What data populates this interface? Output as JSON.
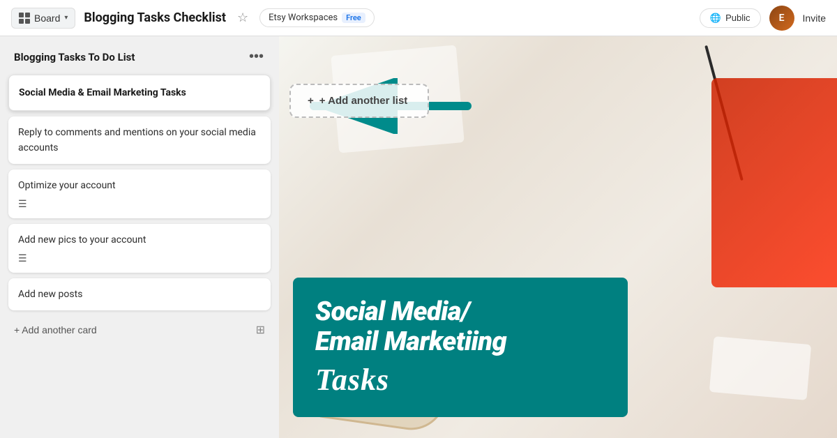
{
  "topbar": {
    "board_label": "Board",
    "page_title": "Blogging Tasks Checklist",
    "star_symbol": "☆",
    "workspace_label": "Etsy Workspaces",
    "free_badge": "Free",
    "public_label": "Public",
    "invite_label": "Invite",
    "avatar_initials": "E"
  },
  "list": {
    "title": "Blogging Tasks To Do List",
    "menu_symbol": "•••",
    "add_another_list": "+ Add another list",
    "cards": [
      {
        "title": "Social Media & Email Marketing Tasks",
        "type": "highlighted"
      },
      {
        "text": "Reply to comments and mentions on your social media accounts",
        "type": "normal"
      },
      {
        "text": "Optimize your account",
        "has_icon": true,
        "type": "normal"
      },
      {
        "text": "Add new pics to your account",
        "has_icon": true,
        "type": "normal"
      },
      {
        "text": "Add new posts",
        "type": "normal"
      }
    ],
    "add_card_label": "+ Add another card",
    "card_icon": "☰",
    "list_icon": "⊞"
  },
  "overlay": {
    "line1": "Social Media/",
    "line2": "Email Marketiing",
    "line3": "Tasks"
  },
  "colors": {
    "teal": "#1a9090",
    "arrow_teal": "#008080"
  }
}
